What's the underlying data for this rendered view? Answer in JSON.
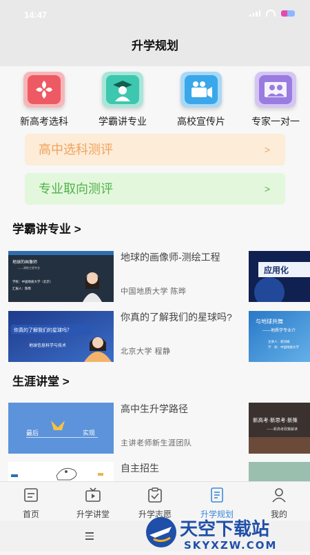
{
  "status": {
    "time": "14:47"
  },
  "header": {
    "title": "升学规划"
  },
  "quicknav": [
    {
      "label": "新高考选科",
      "icon": "flower-icon",
      "color": "#ee5a63"
    },
    {
      "label": "学霸讲专业",
      "icon": "graduate-icon",
      "color": "#3dc7ae"
    },
    {
      "label": "高校宣传片",
      "icon": "video-camera-icon",
      "color": "#3aa7ea"
    },
    {
      "label": "专家一对一",
      "icon": "people-icon",
      "color": "#9a7ce0"
    }
  ],
  "evals": [
    {
      "label": "高中选科测评",
      "chevron": ">",
      "bg": "#fcecd8",
      "color": "#f0a25c"
    },
    {
      "label": "专业取向测评",
      "chevron": ">",
      "bg": "#e3f7dc",
      "color": "#4fb14a"
    }
  ],
  "section1": {
    "title": "学霸讲专业 >",
    "cards": [
      {
        "title": "地球的画像师-测绘工程",
        "meta": "中国地质大学   陈晔",
        "thumb_text": [
          "地球的画像师",
          "——测绘工程专业",
          "学校：中国地质大学（北京）",
          "汇报人：陈晔"
        ]
      },
      {
        "title": "你真的了解我们的星球吗?",
        "meta": "北京大学   程静",
        "thumb_text": [
          "你真的了解我们的星球吗？",
          "地球信息科学与技术"
        ]
      }
    ],
    "peek1": "应用化",
    "peek2": [
      "与地球共舞",
      "——地质学专业介",
      "主讲人：崔同娟",
      "学　校：中国地质大学"
    ]
  },
  "section2": {
    "title": "生涯讲堂 >",
    "cards": [
      {
        "title": "高中生升学路径",
        "meta": "主讲老师新生涯团队",
        "thumb_text": [
          "最后",
          "实现"
        ]
      },
      {
        "title": "自主招生",
        "meta": "",
        "thumb_text": []
      }
    ],
    "peek1": [
      "新高考·新思考·新策",
      "——新高考政策解读"
    ]
  },
  "tabs": [
    {
      "label": "首页",
      "icon": "home-icon"
    },
    {
      "label": "升学讲堂",
      "icon": "tv-play-icon"
    },
    {
      "label": "升学志愿",
      "icon": "clipboard-check-icon"
    },
    {
      "label": "升学规划",
      "icon": "document-icon",
      "active": true
    },
    {
      "label": "我的",
      "icon": "user-icon"
    }
  ],
  "watermark": {
    "cn": "天空下载站",
    "en": "SKYXZW.COM"
  }
}
